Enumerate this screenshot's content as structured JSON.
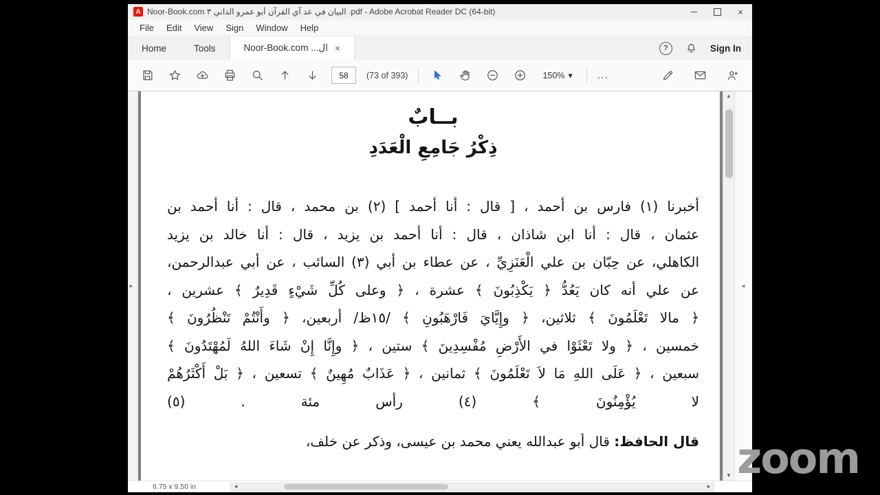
{
  "titlebar": {
    "title": "Noor-Book.com  البيان في عد آي القرآن أبو عمرو الداني ٣ .pdf - Adobe Acrobat Reader DC (64-bit)"
  },
  "menubar": {
    "items": [
      "File",
      "Edit",
      "View",
      "Sign",
      "Window",
      "Help"
    ]
  },
  "tabbar": {
    "home": "Home",
    "tools": "Tools",
    "doc_tab": "Noor-Book.com ...ال",
    "sign_in": "Sign In"
  },
  "toolbar": {
    "page_number": "58",
    "page_count": "(73 of 393)",
    "zoom_level": "150%"
  },
  "icons": {
    "close_window": "×",
    "doc_tab_close": "×",
    "question": "?",
    "caret_down": "▾",
    "ellipsis": "...",
    "scroll_up": "▲",
    "scroll_down": "▼",
    "scroll_left": "◄",
    "scroll_right": "►",
    "pane_expand_right": "►",
    "pane_expand_left": "◄",
    "acrobat_logo": "A"
  },
  "page": {
    "title1": "بــابٌ",
    "title2": "ذِكْرُ جَامِعِ الْعَدَدِ",
    "lines": [
      "أخبرنا (١) فارس بن أحمد ، [ قال : أنا أحمد ] (٢) بن محمد ، قال : أنا أحمد بن",
      "عثمان ، قال : أنا ابن شاذان ، قال : أنا أحمد بن يزيد ، قال : أنا خالد بن يزيد",
      "الكاهلي، عن حِبّان بن علي الْعَنَزِيِّ ، عن عطاء بن أبي (٣) السائب ، عن أبي عبدالرحمن،",
      "عن علي أنه كان يَعُدُّ ﴿ يَكْذِبُونَ ﴾ عشرة ، ﴿ وعلى كُلِّ شَيْءٍ قَدِيرٌ ﴾ عشرين ،",
      "﴿ مالا تَعْلَمُونَ ﴾ ثلاثين، ﴿ وإِيَّايَ فَارْهَبُونِ ﴾ /١٥ظ/ أربعين، ﴿ وأَنْتُمْ تَنْظُرُونَ ﴾",
      "خمسين ، ﴿ ولا تَعْثَوْا في الأَرْضِ مُفْسِدِينَ ﴾ ستين ، ﴿ وإِنَّا إِنْ شَاءَ اللهُ لَمُهْتَدُونَ ﴾",
      "سبعين ، ﴿ عَلَى اللهِ مَا لاَ تَعْلَمُونَ ﴾ ثمانين ، ﴿ عَذَابٌ مُهِينٌ ﴾ تسعين ، ﴿ بَلْ أَكْثَرُهُمْ",
      "لا يُؤْمِنُونَ ﴾ (٤) رأس مئة . (٥)"
    ],
    "footer_bold": "قال الحافظ:",
    "footer_rest": " قال أبو عبدالله يعني محمد بن عيسى، وذكر عن خلف،"
  },
  "statusbar": {
    "page_size": "6.75 x 9.50 in"
  },
  "watermark": {
    "text": "zoom"
  }
}
